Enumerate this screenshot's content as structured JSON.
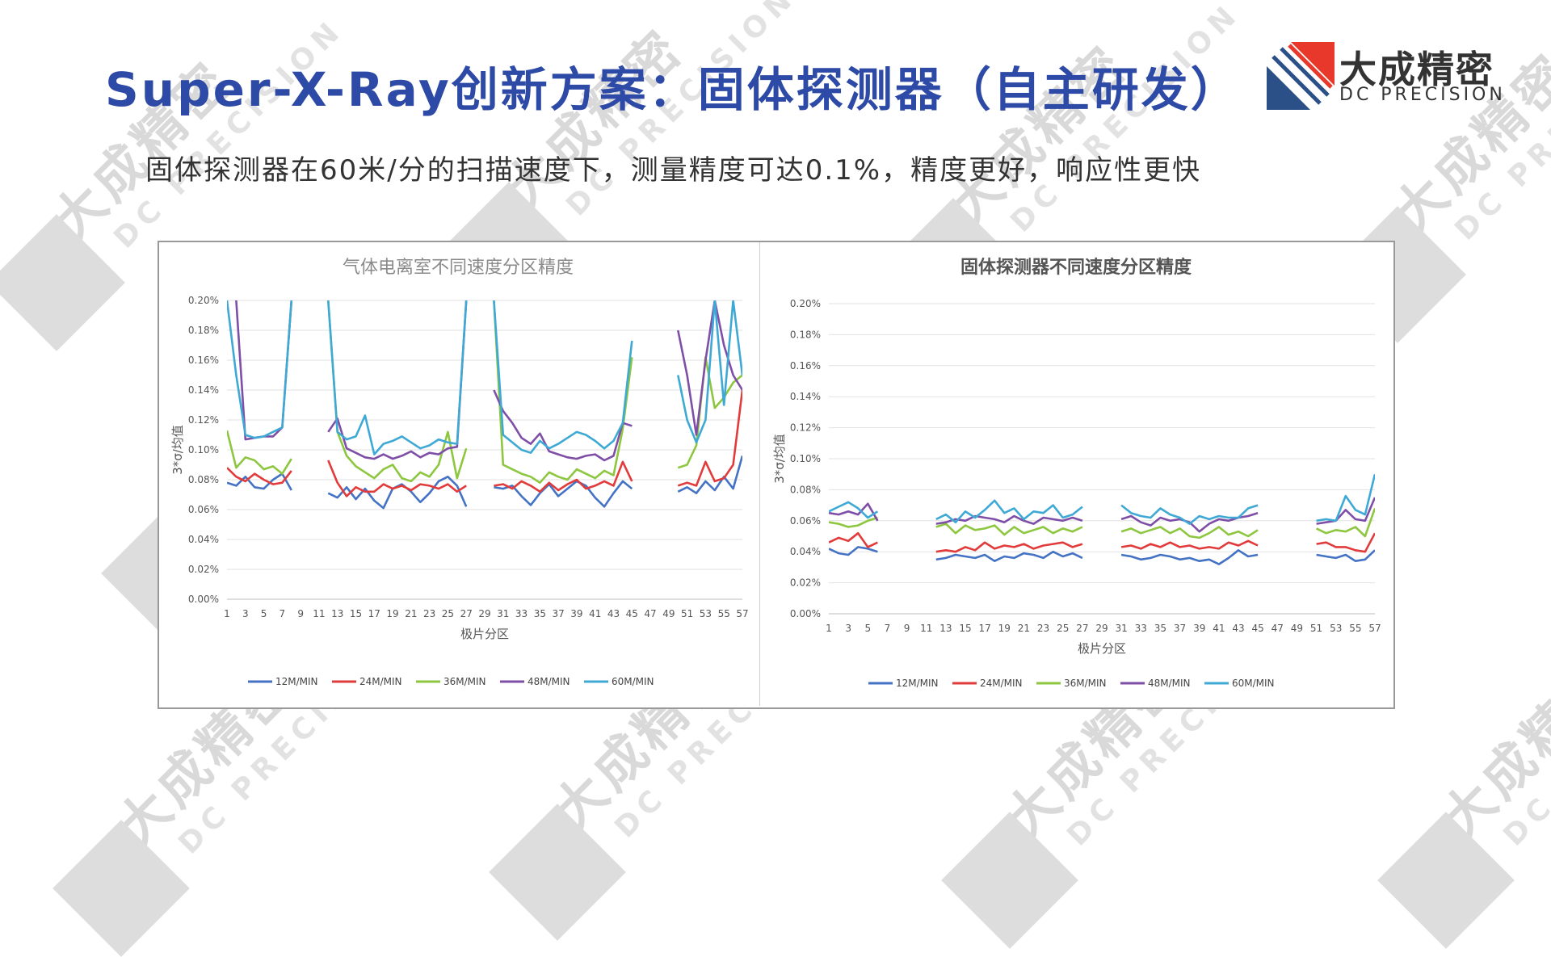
{
  "header": {
    "title": "Super-X-Ray创新方案：固体探测器（自主研发）",
    "subtitle": "固体探测器在60米/分的扫描速度下，测量精度可达0.1%，精度更好，响应性更快"
  },
  "logo": {
    "cn": "大成精密",
    "en": "DC PRECISION",
    "colors": {
      "red": "#e8382c",
      "blue": "#2b4f87"
    }
  },
  "watermark": {
    "cn": "大成精密",
    "en": "DC PRECISION"
  },
  "chart_data": [
    {
      "type": "line",
      "title": "气体电离室不同速度分区精度",
      "xlabel": "极片分区",
      "ylabel": "3*σ/均值",
      "ylim": [
        0,
        0.2
      ],
      "yticks": [
        "0.00%",
        "0.02%",
        "0.04%",
        "0.06%",
        "0.08%",
        "0.10%",
        "0.12%",
        "0.14%",
        "0.16%",
        "0.18%",
        "0.20%"
      ],
      "x_ticks": [
        1,
        3,
        5,
        7,
        9,
        11,
        13,
        15,
        17,
        19,
        21,
        23,
        25,
        27,
        29,
        31,
        33,
        35,
        37,
        39,
        41,
        43,
        45,
        47,
        49,
        51,
        53,
        55,
        57
      ],
      "x": [
        1,
        2,
        3,
        4,
        5,
        6,
        7,
        8,
        9,
        10,
        11,
        12,
        13,
        14,
        15,
        16,
        17,
        18,
        19,
        20,
        21,
        22,
        23,
        24,
        25,
        26,
        27,
        28,
        29,
        30,
        31,
        32,
        33,
        34,
        35,
        36,
        37,
        38,
        39,
        40,
        41,
        42,
        43,
        44,
        45,
        46,
        47,
        48,
        49,
        50,
        51,
        52,
        53,
        54,
        55,
        56,
        57
      ],
      "legend_position": "bottom",
      "series": [
        {
          "name": "12M/MIN",
          "color": "#4472c4",
          "values": [
            0.078,
            0.076,
            0.082,
            0.075,
            0.074,
            0.08,
            0.084,
            0.073,
            null,
            null,
            null,
            0.071,
            0.068,
            0.075,
            0.067,
            0.074,
            0.066,
            0.061,
            0.074,
            0.077,
            0.072,
            0.065,
            0.071,
            0.079,
            0.082,
            0.076,
            0.062,
            null,
            null,
            0.075,
            0.074,
            0.076,
            0.069,
            0.063,
            0.071,
            0.077,
            0.069,
            0.074,
            0.079,
            0.076,
            0.068,
            0.062,
            0.071,
            0.079,
            0.074,
            null,
            null,
            null,
            null,
            0.072,
            0.075,
            0.071,
            0.079,
            0.073,
            0.082,
            0.074,
            0.096
          ]
        },
        {
          "name": "24M/MIN",
          "color": "#e23b3b",
          "values": [
            0.088,
            0.082,
            0.079,
            0.084,
            0.08,
            0.077,
            0.078,
            0.086,
            null,
            null,
            null,
            0.093,
            0.078,
            0.069,
            0.075,
            0.072,
            0.072,
            0.077,
            0.074,
            0.076,
            0.073,
            0.077,
            0.076,
            0.074,
            0.077,
            0.072,
            0.076,
            null,
            null,
            0.076,
            0.077,
            0.074,
            0.079,
            0.076,
            0.072,
            0.078,
            0.073,
            0.077,
            0.08,
            0.074,
            0.076,
            0.079,
            0.076,
            0.092,
            0.079,
            null,
            null,
            null,
            null,
            0.076,
            0.078,
            0.076,
            0.092,
            0.079,
            0.081,
            0.09,
            0.14
          ]
        },
        {
          "name": "36M/MIN",
          "color": "#8dc63f",
          "values": [
            0.113,
            0.088,
            0.095,
            0.093,
            0.087,
            0.089,
            0.084,
            0.094,
            null,
            null,
            null,
            0.2,
            0.112,
            0.096,
            0.089,
            0.085,
            0.081,
            0.087,
            0.09,
            0.081,
            0.079,
            0.085,
            0.082,
            0.09,
            0.112,
            0.081,
            0.101,
            null,
            null,
            0.2,
            0.09,
            0.087,
            0.084,
            0.082,
            0.078,
            0.085,
            0.082,
            0.08,
            0.087,
            0.084,
            0.081,
            0.086,
            0.083,
            0.114,
            0.162,
            null,
            null,
            null,
            null,
            0.088,
            0.09,
            0.103,
            0.162,
            0.128,
            0.135,
            0.145,
            0.15
          ]
        },
        {
          "name": "48M/MIN",
          "color": "#7f4fa8",
          "values": [
            0.21,
            0.2,
            0.107,
            0.108,
            0.109,
            0.109,
            0.115,
            0.2,
            null,
            null,
            null,
            0.112,
            0.121,
            0.101,
            0.098,
            0.095,
            0.094,
            0.097,
            0.094,
            0.096,
            0.099,
            0.095,
            0.098,
            0.097,
            0.101,
            0.102,
            0.2,
            null,
            null,
            0.14,
            0.126,
            0.118,
            0.108,
            0.104,
            0.111,
            0.099,
            0.097,
            0.095,
            0.094,
            0.096,
            0.097,
            0.093,
            0.096,
            0.118,
            0.116,
            null,
            null,
            null,
            null,
            0.18,
            0.15,
            0.11,
            0.16,
            0.2,
            0.17,
            0.15,
            0.14
          ]
        },
        {
          "name": "60M/MIN",
          "color": "#3fa9d5",
          "values": [
            0.2,
            0.15,
            0.11,
            0.108,
            0.109,
            0.112,
            0.115,
            0.2,
            null,
            null,
            null,
            0.2,
            0.112,
            0.107,
            0.109,
            0.123,
            0.097,
            0.104,
            0.106,
            0.109,
            0.105,
            0.101,
            0.103,
            0.107,
            0.105,
            0.104,
            0.2,
            null,
            null,
            0.2,
            0.11,
            0.105,
            0.1,
            0.098,
            0.106,
            0.101,
            0.104,
            0.108,
            0.112,
            0.11,
            0.106,
            0.101,
            0.106,
            0.118,
            0.173,
            null,
            null,
            null,
            null,
            0.15,
            0.12,
            0.105,
            0.12,
            0.2,
            0.13,
            0.2,
            0.15
          ]
        }
      ]
    },
    {
      "type": "line",
      "title": "固体探测器不同速度分区精度",
      "xlabel": "极片分区",
      "ylabel": "3*σ/均值",
      "ylim": [
        0,
        0.2
      ],
      "yticks": [
        "0.00%",
        "0.02%",
        "0.04%",
        "0.06%",
        "0.08%",
        "0.10%",
        "0.12%",
        "0.14%",
        "0.16%",
        "0.18%",
        "0.20%"
      ],
      "x_ticks": [
        1,
        3,
        5,
        7,
        9,
        11,
        13,
        15,
        17,
        19,
        21,
        23,
        25,
        27,
        29,
        31,
        33,
        35,
        37,
        39,
        41,
        43,
        45,
        47,
        49,
        51,
        53,
        55,
        57
      ],
      "x": [
        1,
        2,
        3,
        4,
        5,
        6,
        7,
        8,
        9,
        10,
        11,
        12,
        13,
        14,
        15,
        16,
        17,
        18,
        19,
        20,
        21,
        22,
        23,
        24,
        25,
        26,
        27,
        28,
        29,
        30,
        31,
        32,
        33,
        34,
        35,
        36,
        37,
        38,
        39,
        40,
        41,
        42,
        43,
        44,
        45,
        46,
        47,
        48,
        49,
        50,
        51,
        52,
        53,
        54,
        55,
        56,
        57
      ],
      "legend_position": "bottom",
      "series": [
        {
          "name": "12M/MIN",
          "color": "#4472c4",
          "values": [
            0.042,
            0.039,
            0.038,
            0.043,
            0.042,
            0.04,
            null,
            null,
            null,
            null,
            null,
            0.035,
            0.036,
            0.038,
            0.037,
            0.036,
            0.038,
            0.034,
            0.037,
            0.036,
            0.039,
            0.038,
            0.036,
            0.04,
            0.037,
            0.039,
            0.036,
            null,
            null,
            null,
            0.038,
            0.037,
            0.035,
            0.036,
            0.038,
            0.037,
            0.035,
            0.036,
            0.034,
            0.035,
            0.032,
            0.036,
            0.041,
            0.037,
            0.038,
            null,
            null,
            null,
            null,
            null,
            0.038,
            0.037,
            0.036,
            0.038,
            0.034,
            0.035,
            0.041
          ]
        },
        {
          "name": "24M/MIN",
          "color": "#e23b3b",
          "values": [
            0.046,
            0.049,
            0.047,
            0.052,
            0.043,
            0.046,
            null,
            null,
            null,
            null,
            null,
            0.04,
            0.041,
            0.04,
            0.043,
            0.041,
            0.046,
            0.042,
            0.044,
            0.043,
            0.045,
            0.042,
            0.044,
            0.045,
            0.046,
            0.043,
            0.045,
            null,
            null,
            null,
            0.043,
            0.044,
            0.042,
            0.045,
            0.043,
            0.046,
            0.043,
            0.044,
            0.042,
            0.043,
            0.042,
            0.046,
            0.044,
            0.047,
            0.044,
            null,
            null,
            null,
            null,
            null,
            0.045,
            0.046,
            0.043,
            0.043,
            0.041,
            0.04,
            0.052
          ]
        },
        {
          "name": "36M/MIN",
          "color": "#8dc63f",
          "values": [
            0.059,
            0.058,
            0.056,
            0.057,
            0.06,
            0.062,
            null,
            null,
            null,
            null,
            null,
            0.056,
            0.058,
            0.052,
            0.057,
            0.054,
            0.055,
            0.057,
            0.051,
            0.056,
            0.052,
            0.054,
            0.056,
            0.052,
            0.055,
            0.053,
            0.056,
            null,
            null,
            null,
            0.053,
            0.055,
            0.052,
            0.054,
            0.056,
            0.052,
            0.055,
            0.05,
            0.049,
            0.052,
            0.056,
            0.051,
            0.053,
            0.05,
            0.054,
            null,
            null,
            null,
            null,
            null,
            0.055,
            0.052,
            0.054,
            0.053,
            0.056,
            0.05,
            0.068
          ]
        },
        {
          "name": "48M/MIN",
          "color": "#7f4fa8",
          "values": [
            0.065,
            0.064,
            0.066,
            0.064,
            0.071,
            0.06,
            null,
            null,
            null,
            null,
            null,
            0.058,
            0.059,
            0.061,
            0.06,
            0.063,
            0.062,
            0.061,
            0.059,
            0.063,
            0.06,
            0.058,
            0.062,
            0.061,
            0.06,
            0.062,
            0.06,
            null,
            null,
            null,
            0.061,
            0.063,
            0.059,
            0.057,
            0.062,
            0.06,
            0.061,
            0.059,
            0.053,
            0.058,
            0.061,
            0.06,
            0.062,
            0.063,
            0.065,
            null,
            null,
            null,
            null,
            null,
            0.058,
            0.059,
            0.06,
            0.067,
            0.061,
            0.06,
            0.075
          ]
        },
        {
          "name": "60M/MIN",
          "color": "#3fa9d5",
          "values": [
            0.066,
            0.069,
            0.072,
            0.068,
            0.062,
            0.066,
            null,
            null,
            null,
            null,
            null,
            0.061,
            0.064,
            0.059,
            0.066,
            0.062,
            0.067,
            0.073,
            0.065,
            0.068,
            0.061,
            0.066,
            0.065,
            0.07,
            0.062,
            0.064,
            0.069,
            null,
            null,
            null,
            0.07,
            0.065,
            0.063,
            0.062,
            0.068,
            0.064,
            0.062,
            0.058,
            0.063,
            0.061,
            0.063,
            0.062,
            0.062,
            0.068,
            0.07,
            null,
            null,
            null,
            null,
            null,
            0.06,
            0.061,
            0.06,
            0.076,
            0.067,
            0.064,
            0.09
          ]
        }
      ]
    }
  ]
}
